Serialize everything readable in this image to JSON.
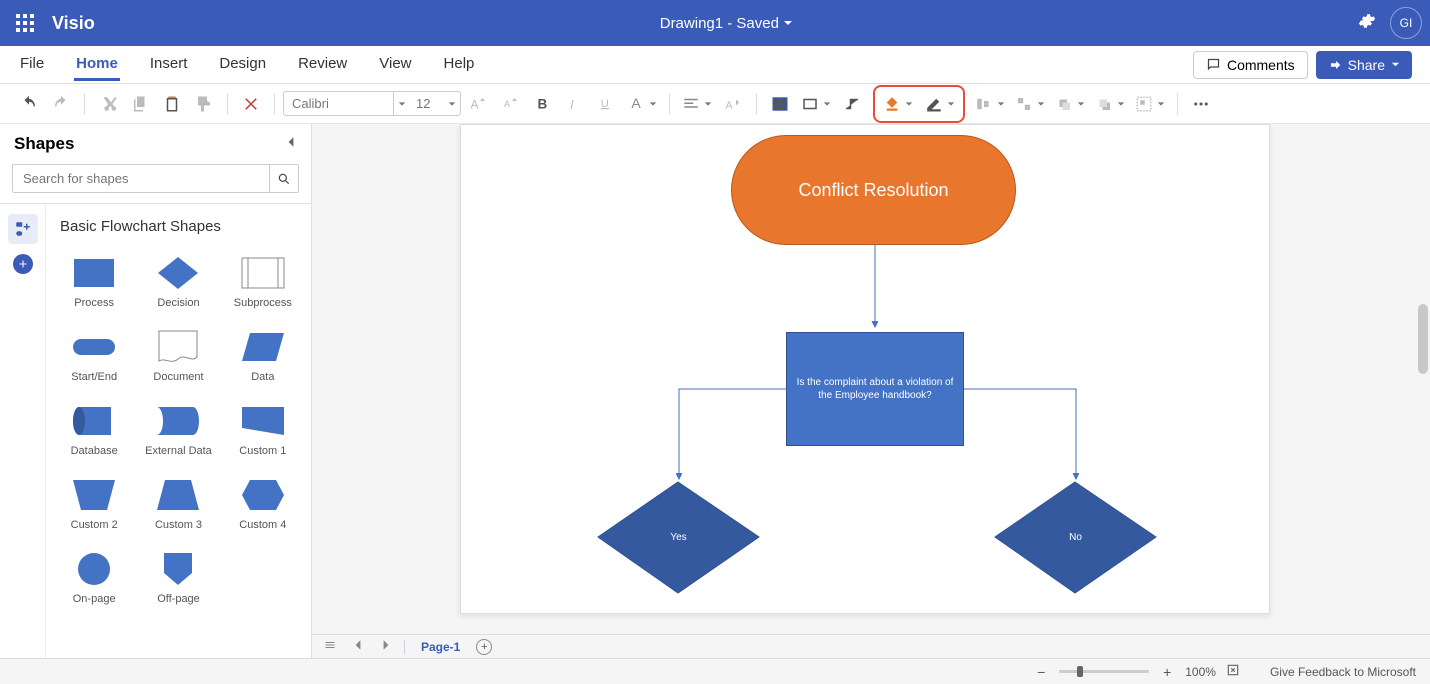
{
  "app": {
    "name": "Visio",
    "doc_title": "Drawing1  -  Saved",
    "avatar": "GI"
  },
  "menu": {
    "items": [
      "File",
      "Home",
      "Insert",
      "Design",
      "Review",
      "View",
      "Help"
    ],
    "active_index": 1,
    "comments": "Comments",
    "share": "Share"
  },
  "toolbar": {
    "font_name": "Calibri",
    "font_size": "12"
  },
  "shapes": {
    "title": "Shapes",
    "search_placeholder": "Search for shapes",
    "category": "Basic Flowchart Shapes",
    "items": [
      "Process",
      "Decision",
      "Subprocess",
      "Start/End",
      "Document",
      "Data",
      "Database",
      "External Data",
      "Custom 1",
      "Custom 2",
      "Custom 3",
      "Custom 4",
      "On-page",
      "Off-page"
    ]
  },
  "canvas": {
    "terminator": "Conflict Resolution",
    "question": "Is the complaint about a violation of the Employee handbook?",
    "yes": "Yes",
    "no": "No"
  },
  "pages": {
    "current": "Page-1"
  },
  "status": {
    "zoom": "100%",
    "feedback": "Give Feedback to Microsoft"
  }
}
